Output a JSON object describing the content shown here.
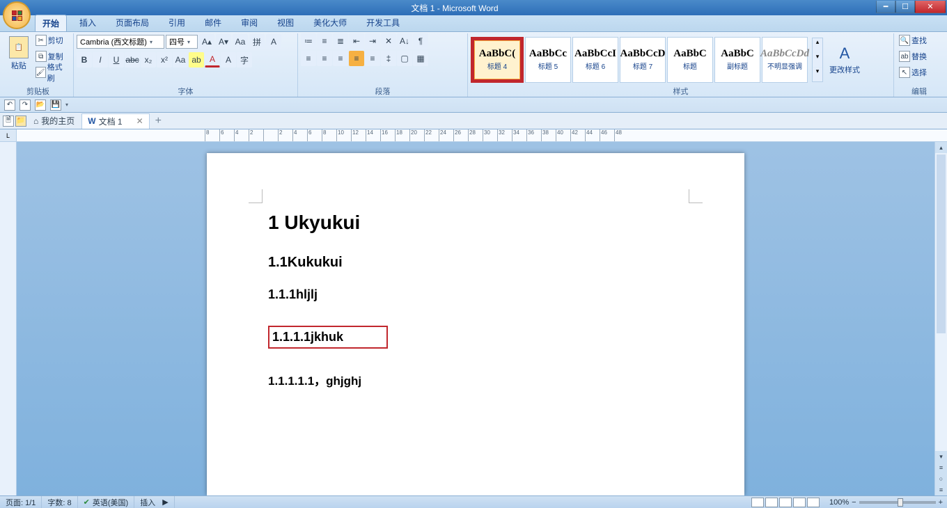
{
  "window": {
    "title": "文档 1 - Microsoft Word"
  },
  "tabs": {
    "items": [
      "开始",
      "插入",
      "页面布局",
      "引用",
      "邮件",
      "审阅",
      "视图",
      "美化大师",
      "开发工具"
    ],
    "active": "开始"
  },
  "ribbon": {
    "clipboard": {
      "paste": "粘贴",
      "cut": "剪切",
      "copy": "复制",
      "brush": "格式刷",
      "label": "剪贴板"
    },
    "font": {
      "name": "Cambria (西文标题)",
      "size": "四号",
      "label": "字体",
      "bold": "B",
      "italic": "I",
      "underline": "U",
      "strike": "abc",
      "sub": "x₂",
      "sup": "x²",
      "case": "Aa",
      "phonetic": "拼",
      "charborder": "A",
      "highlight": "ab",
      "color": "A",
      "clear": "A",
      "circled": "字"
    },
    "paragraph": {
      "label": "段落"
    },
    "styles": {
      "label": "样式",
      "change": "更改样式",
      "items": [
        {
          "sample": "AaBbC(",
          "name": "标题 4",
          "selected": true
        },
        {
          "sample": "AaBbCc",
          "name": "标题 5"
        },
        {
          "sample": "AaBbCcI",
          "name": "标题 6"
        },
        {
          "sample": "AaBbCcD",
          "name": "标题 7"
        },
        {
          "sample": "AaBbC",
          "name": "标题"
        },
        {
          "sample": "AaBbC",
          "name": "副标题"
        },
        {
          "sample": "AaBbCcDd",
          "name": "不明显强调",
          "muted": true
        }
      ]
    },
    "editing": {
      "find": "查找",
      "replace": "替换",
      "select": "选择",
      "label": "编辑"
    }
  },
  "doctabs": {
    "home": "我的主页",
    "doc": "文档 1"
  },
  "ruler": {
    "values": [
      "8",
      "6",
      "4",
      "2",
      "",
      "2",
      "4",
      "6",
      "8",
      "10",
      "12",
      "14",
      "16",
      "18",
      "20",
      "22",
      "24",
      "26",
      "28",
      "30",
      "32",
      "34",
      "36",
      "38",
      "40",
      "42",
      "44",
      "46",
      "48"
    ]
  },
  "document": {
    "h1": "1 Ukyukui",
    "h2": "1.1Kukukui",
    "h3": "1.1.1hljlj",
    "h4": "1.1.1.1jkhuk",
    "h5": "1.1.1.1.1，ghjghj"
  },
  "status": {
    "page": "页面: 1/1",
    "words": "字数: 8",
    "lang": "英语(美国)",
    "insert": "插入",
    "zoom": "100%"
  }
}
